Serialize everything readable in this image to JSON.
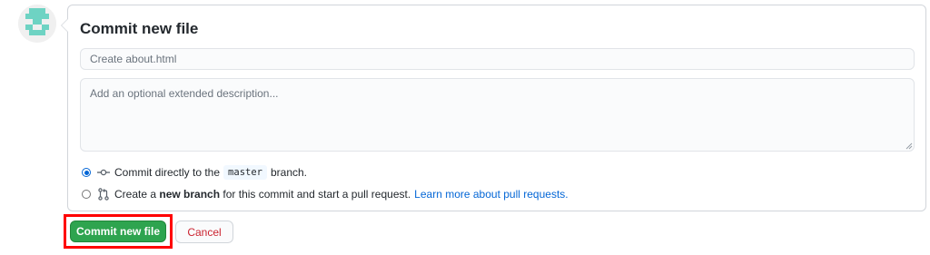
{
  "form": {
    "title": "Commit new file",
    "summary_placeholder": "Create about.html",
    "description_placeholder": "Add an optional extended description..."
  },
  "options": {
    "direct": {
      "selected": true,
      "prefix": "Commit directly to the",
      "branch": "master",
      "suffix": "branch."
    },
    "new_branch": {
      "selected": false,
      "prefix": "Create a",
      "bold": "new branch",
      "suffix": "for this commit and start a pull request.",
      "link": "Learn more about pull requests."
    }
  },
  "buttons": {
    "commit": "Commit new file",
    "cancel": "Cancel"
  },
  "icons": {
    "avatar": "identicon-avatar",
    "commit": "git-commit-icon",
    "pull_request": "git-pull-request-icon"
  },
  "colors": {
    "primary_button": "#2ea44f",
    "link": "#0366d6",
    "cancel_text": "#cb2431",
    "highlight": "#ff0000"
  }
}
